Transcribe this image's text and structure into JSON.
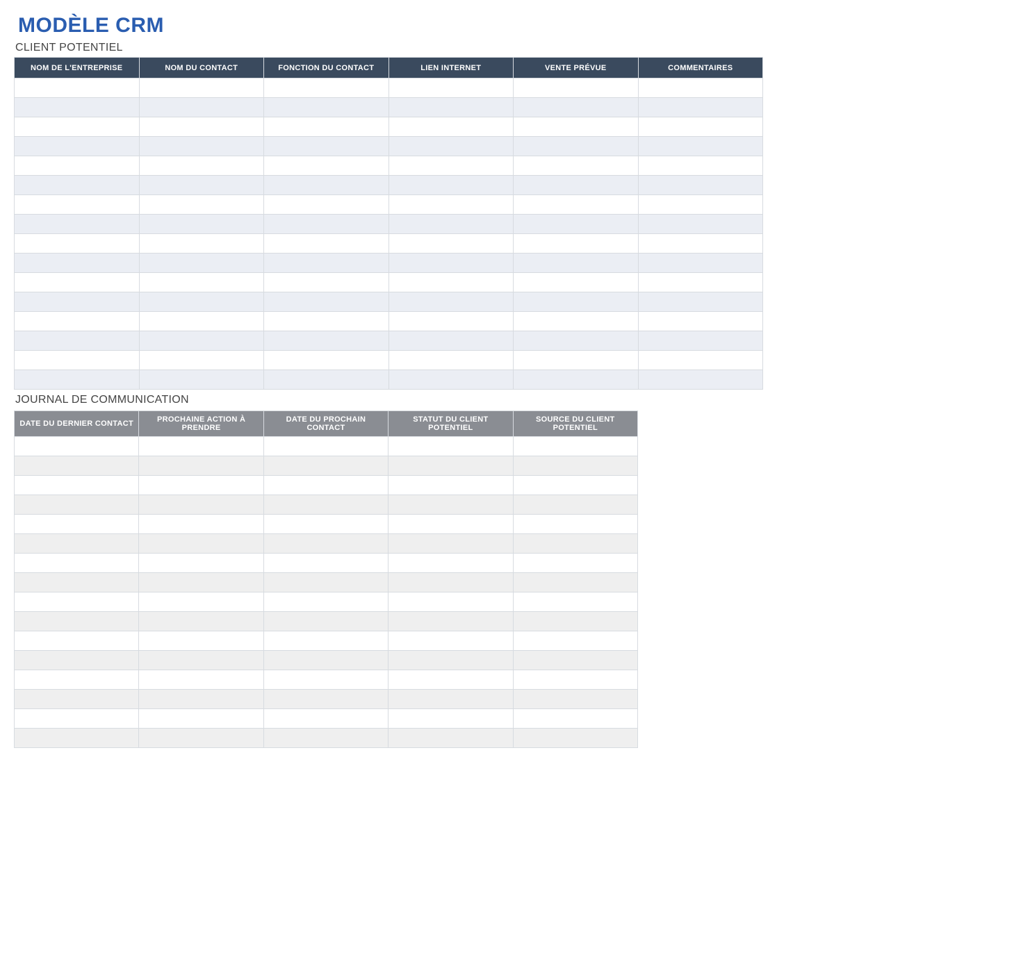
{
  "title": "MODÈLE CRM",
  "client_section": {
    "heading": "CLIENT POTENTIEL",
    "columns": [
      "NOM DE L'ENTREPRISE",
      "NOM DU CONTACT",
      "FONCTION DU CONTACT",
      "LIEN INTERNET",
      "VENTE PRÉVUE",
      "COMMENTAIRES"
    ],
    "row_count": 16
  },
  "journal_section": {
    "heading": "JOURNAL DE COMMUNICATION",
    "columns": [
      "DATE DU DERNIER CONTACT",
      "PROCHAINE ACTION À PRENDRE",
      "DATE DU PROCHAIN CONTACT",
      "STATUT DU CLIENT POTENTIEL",
      "SOURCE DU CLIENT POTENTIEL"
    ],
    "row_count": 16
  }
}
